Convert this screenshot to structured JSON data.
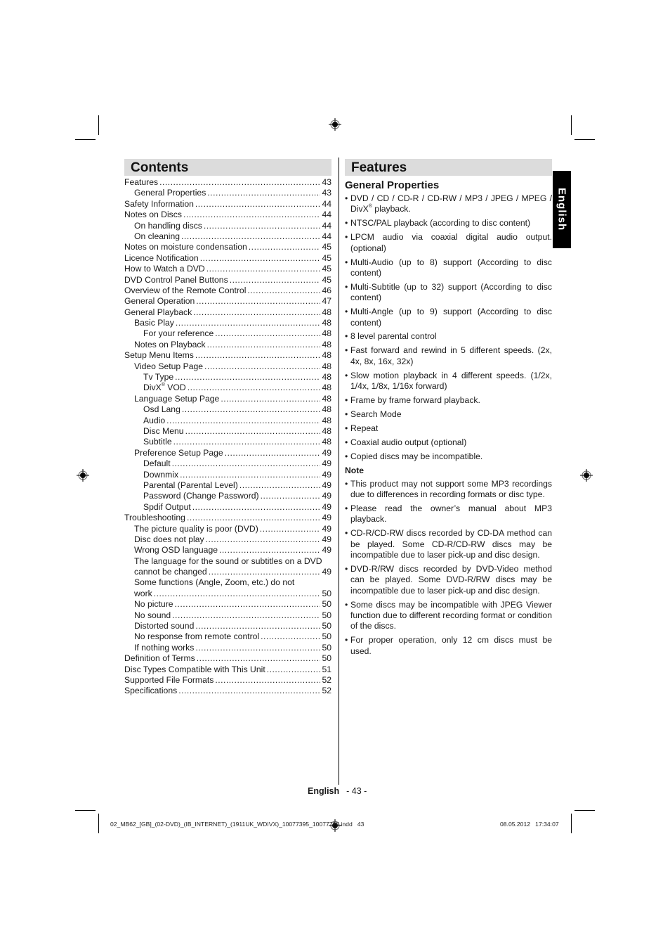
{
  "contents": {
    "title": "Contents",
    "entries": [
      {
        "title": "Features",
        "page": "43",
        "level": 0
      },
      {
        "title": "General Properties",
        "page": "43",
        "level": 1
      },
      {
        "title": "Safety Information",
        "page": "44",
        "level": 0
      },
      {
        "title": "Notes on Discs",
        "page": "44",
        "level": 0
      },
      {
        "title": "On handling discs",
        "page": "44",
        "level": 1
      },
      {
        "title": "On cleaning",
        "page": "44",
        "level": 1
      },
      {
        "title": "Notes on moisture condensation",
        "page": "45",
        "level": 0
      },
      {
        "title": "Licence Notification",
        "page": "45",
        "level": 0
      },
      {
        "title": "How to Watch a DVD",
        "page": "45",
        "level": 0
      },
      {
        "title": "DVD Control Panel Buttons",
        "page": "45",
        "level": 0
      },
      {
        "title": "Overview of the Remote Control",
        "page": "46",
        "level": 0
      },
      {
        "title": "General Operation",
        "page": "47",
        "level": 0
      },
      {
        "title": "General Playback",
        "page": "48",
        "level": 0
      },
      {
        "title": "Basic Play",
        "page": "48",
        "level": 1
      },
      {
        "title": "For your reference",
        "page": "48",
        "level": 2
      },
      {
        "title": "Notes on Playback",
        "page": "48",
        "level": 1
      },
      {
        "title": "Setup Menu Items",
        "page": "48",
        "level": 0
      },
      {
        "title": "Video Setup Page",
        "page": "48",
        "level": 1
      },
      {
        "title": "Tv Type",
        "page": "48",
        "level": 2
      },
      {
        "title": "DivX® VOD",
        "page": "48",
        "level": 2
      },
      {
        "title": "Language Setup Page",
        "page": "48",
        "level": 1
      },
      {
        "title": "Osd Lang",
        "page": "48",
        "level": 2
      },
      {
        "title": "Audio",
        "page": "48",
        "level": 2
      },
      {
        "title": "Disc Menu",
        "page": "48",
        "level": 2
      },
      {
        "title": "Subtitle",
        "page": "48",
        "level": 2
      },
      {
        "title": "Preference Setup Page",
        "page": "49",
        "level": 1
      },
      {
        "title": "Default",
        "page": "49",
        "level": 2
      },
      {
        "title": "Downmix",
        "page": "49",
        "level": 2
      },
      {
        "title": "Parental (Parental Level)",
        "page": "49",
        "level": 2
      },
      {
        "title": "Password (Change Password)",
        "page": "49",
        "level": 2
      },
      {
        "title": "Spdif Output",
        "page": "49",
        "level": 2
      },
      {
        "title": "Troubleshooting",
        "page": "49",
        "level": 0
      },
      {
        "title": "The picture quality is poor (DVD)",
        "page": "49",
        "level": 1
      },
      {
        "title": "Disc does not play",
        "page": "49",
        "level": 1
      },
      {
        "title": "Wrong OSD language",
        "page": "49",
        "level": 1
      },
      {
        "title": "The language for the sound or subtitles on a DVD",
        "page": "",
        "level": 1,
        "nodots": true
      },
      {
        "title": "cannot be changed",
        "page": "49",
        "level": 1
      },
      {
        "title": "Some functions (Angle, Zoom, etc.) do not",
        "page": "",
        "level": 1,
        "nodots": true
      },
      {
        "title": "work",
        "page": "50",
        "level": 1
      },
      {
        "title": "No picture",
        "page": "50",
        "level": 1
      },
      {
        "title": "No sound",
        "page": "50",
        "level": 1
      },
      {
        "title": "Distorted sound",
        "page": "50",
        "level": 1
      },
      {
        "title": "No response from remote control",
        "page": "50",
        "level": 1
      },
      {
        "title": "If nothing works",
        "page": "50",
        "level": 1
      },
      {
        "title": "Definition of Terms",
        "page": "50",
        "level": 0
      },
      {
        "title": "Disc Types Compatible with This Unit",
        "page": "51",
        "level": 0
      },
      {
        "title": "Supported File Formats",
        "page": "52",
        "level": 0
      },
      {
        "title": "Specifications",
        "page": "52",
        "level": 0
      }
    ]
  },
  "features": {
    "title": "Features",
    "subtitle": "General Properties",
    "items": [
      "DVD / CD / CD-R / CD-RW / MP3 / JPEG / MPEG / DivX® playback.",
      "NTSC/PAL playback (according to disc content)",
      "LPCM audio via coaxial digital audio output. (optional)",
      "Multi-Audio (up to 8) support (According to disc content)",
      "Multi-Subtitle (up to 32) support (According to disc content)",
      "Multi-Angle (up to 9) support (According to disc content)",
      "8 level parental control",
      "Fast forward and rewind in 5 different speeds. (2x, 4x, 8x, 16x, 32x)",
      "Slow motion playback in 4 different speeds. (1/2x, 1/4x, 1/8x, 1/16x forward)",
      "Frame by frame forward playback.",
      "Search Mode",
      "Repeat",
      "Coaxial audio output (optional)",
      "Copied discs may be incompatible."
    ],
    "note_title": "Note",
    "notes": [
      "This product may not support some MP3 recordings due to differences in recording formats or disc type.",
      "Please read the owner’s manual about MP3 playback.",
      "CD-R/CD-RW discs recorded by CD-DA method can be played. Some CD-R/CD-RW discs may be incompatible due to laser pick-up and disc design.",
      "DVD-R/RW discs recorded by DVD-Video method can be played. Some DVD-R/RW discs may be incompatible due to laser pick-up and disc design.",
      "Some discs may be incompatible with JPEG Viewer function due to different recording format or condition of the discs.",
      "For proper operation, only 12 cm discs must be used."
    ]
  },
  "side_tab": {
    "label": "English"
  },
  "footer": {
    "language": "English",
    "page_number": "- 43 -",
    "slug_file": "02_MB62_[GB]_(02-DVD)_(IB_INTERNET)_(1911UK_WDIVX)_10077395_10077725.indd   43",
    "slug_date": "08.05.2012   17:34:07"
  },
  "icons": {
    "registration_mark": "registration-target-icon"
  }
}
